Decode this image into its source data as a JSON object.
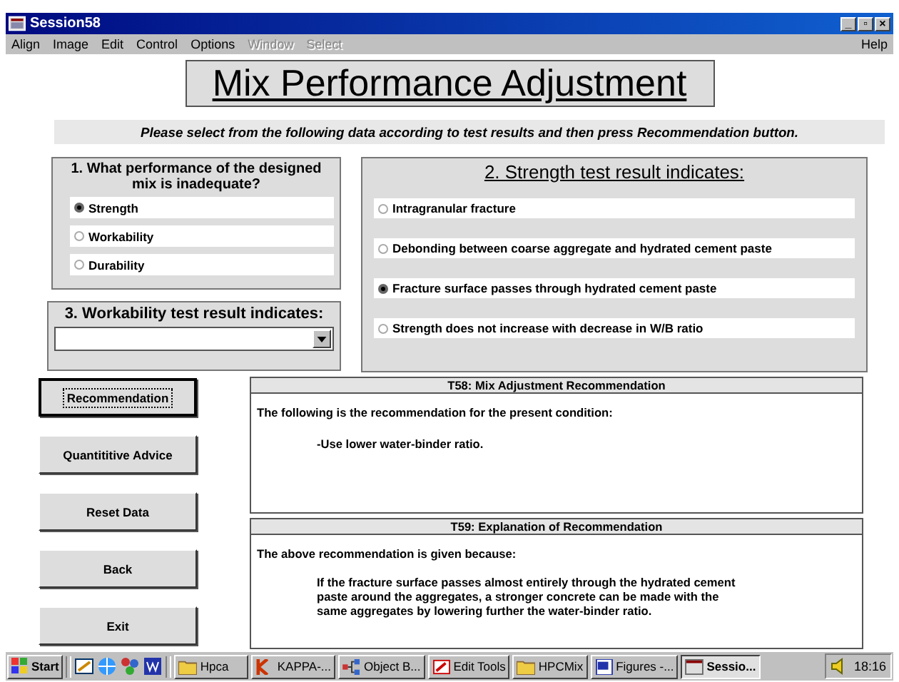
{
  "window": {
    "title": "Session58",
    "controls": [
      "_",
      "▫",
      "×"
    ]
  },
  "menu": [
    {
      "label": "Align",
      "disabled": false
    },
    {
      "label": "Image",
      "disabled": false
    },
    {
      "label": "Edit",
      "disabled": false
    },
    {
      "label": "Control",
      "disabled": false
    },
    {
      "label": "Options",
      "disabled": false
    },
    {
      "label": "Window",
      "disabled": true
    },
    {
      "label": "Select",
      "disabled": true
    }
  ],
  "help_menu": "Help",
  "heading": "Mix Performance Adjustment",
  "instruction": "Please select from the following data according to test results and then press Recommendation button.",
  "question1": {
    "title": "1. What performance of the designed mix is inadequate?",
    "options": [
      {
        "label": "Strength",
        "selected": true
      },
      {
        "label": "Workability",
        "selected": false
      },
      {
        "label": "Durability",
        "selected": false
      }
    ]
  },
  "question3": {
    "title": "3. Workability test result indicates:"
  },
  "question2": {
    "title": "2. Strength test result indicates:",
    "options": [
      {
        "label": "Intragranular fracture",
        "selected": false
      },
      {
        "label": "Debonding between coarse aggregate and hydrated cement paste",
        "selected": false
      },
      {
        "label": "Fracture surface passes through hydrated cement paste",
        "selected": true
      },
      {
        "label": "Strength does not increase with decrease in W/B ratio",
        "selected": false
      }
    ]
  },
  "buttons": [
    {
      "label": "Recommendation",
      "focused": true
    },
    {
      "label": "Quantititive Advice",
      "focused": false
    },
    {
      "label": "Reset Data",
      "focused": false
    },
    {
      "label": "Back",
      "focused": false
    },
    {
      "label": "Exit",
      "focused": false
    }
  ],
  "panels": [
    {
      "title": "T58: Mix Adjustment Recommendation",
      "intro": "The following is the recommendation for the present condition:",
      "body": "-Use lower water-binder ratio."
    },
    {
      "title": "T59: Explanation of Recommendation",
      "intro": "The above recommendation is given because:",
      "body": "If the fracture surface passes almost entirely through the hydrated cement paste around the aggregates, a stronger concrete can be made with the same aggregates by lowering further the water-binder ratio."
    }
  ],
  "taskbar": {
    "start": "Start",
    "tasks": [
      {
        "label": "Hpca",
        "kind": "folder",
        "selected": false
      },
      {
        "label": "KAPPA-...",
        "kind": "kappa",
        "selected": false
      },
      {
        "label": "Object B...",
        "kind": "diagram",
        "selected": false
      },
      {
        "label": "Edit Tools",
        "kind": "tools",
        "selected": false
      },
      {
        "label": "HPCMix",
        "kind": "folder",
        "selected": false
      },
      {
        "label": "Figures -...",
        "kind": "word",
        "selected": false
      },
      {
        "label": "Sessio...",
        "kind": "window",
        "selected": true
      }
    ],
    "clock": "18:16"
  }
}
